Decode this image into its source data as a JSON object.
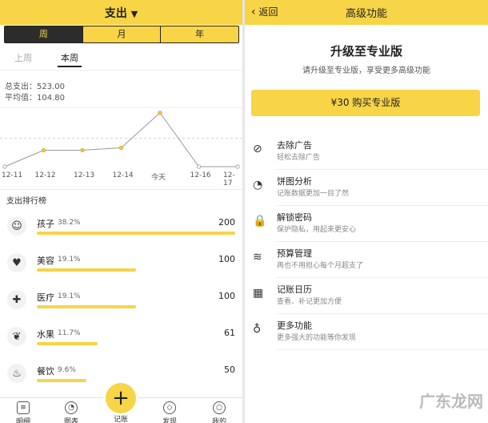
{
  "left": {
    "title": "支出",
    "segments": [
      "周",
      "月",
      "年"
    ],
    "subtabs": [
      "上周",
      "本周"
    ],
    "total_label": "总支出：523.00",
    "avg_label": "平均值：104.80",
    "ranking_title": "支出排行榜",
    "ranking": [
      {
        "name": "孩子",
        "pct": "38.2%",
        "amount": "200",
        "ratio": 1.0,
        "icon": "child-icon"
      },
      {
        "name": "美容",
        "pct": "19.1%",
        "amount": "100",
        "ratio": 0.5,
        "icon": "beauty-icon"
      },
      {
        "name": "医疗",
        "pct": "19.1%",
        "amount": "100",
        "ratio": 0.5,
        "icon": "medical-icon"
      },
      {
        "name": "水果",
        "pct": "11.7%",
        "amount": "61",
        "ratio": 0.305,
        "icon": "cherry-icon"
      },
      {
        "name": "餐饮",
        "pct": "9.6%",
        "amount": "50",
        "ratio": 0.25,
        "icon": "food-icon"
      }
    ],
    "nav": [
      "明细",
      "图表",
      "记账",
      "发现",
      "我的"
    ]
  },
  "chart_data": {
    "type": "line",
    "categories": [
      "12-11",
      "12-12",
      "12-13",
      "12-14",
      "今天",
      "12-16",
      "12-17"
    ],
    "values": [
      0,
      61,
      61,
      70,
      200,
      0,
      0
    ],
    "average": 104.8,
    "ylim": [
      0,
      220
    ],
    "grid": true
  },
  "right": {
    "back_label": "返回",
    "title": "高级功能",
    "pro_title": "升级至专业版",
    "pro_subtitle": "请升级至专业版，享受更多高级功能",
    "buy_label": "¥30 购买专业版",
    "features": [
      {
        "title": "去除广告",
        "sub": "轻松去除广告",
        "icon": "no-ads-icon"
      },
      {
        "title": "饼图分析",
        "sub": "记账数据更加一目了然",
        "icon": "pie-chart-icon"
      },
      {
        "title": "解锁密码",
        "sub": "保护隐私，用起来更安心",
        "icon": "lock-icon"
      },
      {
        "title": "预算管理",
        "sub": "再也不用担心每个月超支了",
        "icon": "coins-icon"
      },
      {
        "title": "记账日历",
        "sub": "查看、补记更加方便",
        "icon": "calendar-icon"
      },
      {
        "title": "更多功能",
        "sub": "更多强大的功能等你发现",
        "icon": "bulb-icon"
      }
    ]
  },
  "watermark": "广东龙网",
  "colors": {
    "accent": "#f8d447",
    "dark": "#2c2c2c"
  }
}
